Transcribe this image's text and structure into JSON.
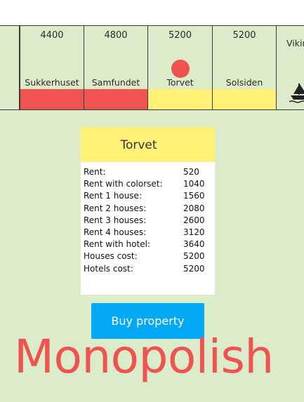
{
  "tiles": [
    {
      "price": "4400",
      "name": "Sukkerhuset",
      "color": "#ef5350"
    },
    {
      "price": "4800",
      "name": "Samfundet",
      "color": "#ef5350"
    },
    {
      "price": "5200",
      "name": "Torvet",
      "color": "#fff176",
      "has_token": true
    },
    {
      "price": "5200",
      "name": "Solsiden",
      "color": "#fff176"
    },
    {
      "name": "Vikin",
      "icon": "ship-icon"
    }
  ],
  "token_color": "#ef5350",
  "card": {
    "title": "Torvet",
    "header_color": "#fff176",
    "rows": [
      {
        "label": "Rent:",
        "value": "520"
      },
      {
        "label": "Rent with colorset:",
        "value": "1040"
      },
      {
        "label": "Rent 1 house:",
        "value": "1560"
      },
      {
        "label": "Rent 2 houses:",
        "value": "2080"
      },
      {
        "label": "Rent 3 houses:",
        "value": "2600"
      },
      {
        "label": "Rent 4 houses:",
        "value": "3120"
      },
      {
        "label": "Rent with hotel:",
        "value": "3640"
      },
      {
        "label": "Houses cost:",
        "value": "5200"
      },
      {
        "label": "Hotels cost:",
        "value": "5200"
      }
    ]
  },
  "buy_button_label": "Buy property",
  "logo_text": "Monopolish",
  "colors": {
    "board_background": "#dcebc9",
    "red_set": "#ef5350",
    "yellow_set": "#fff176",
    "button": "#03a9f4"
  }
}
